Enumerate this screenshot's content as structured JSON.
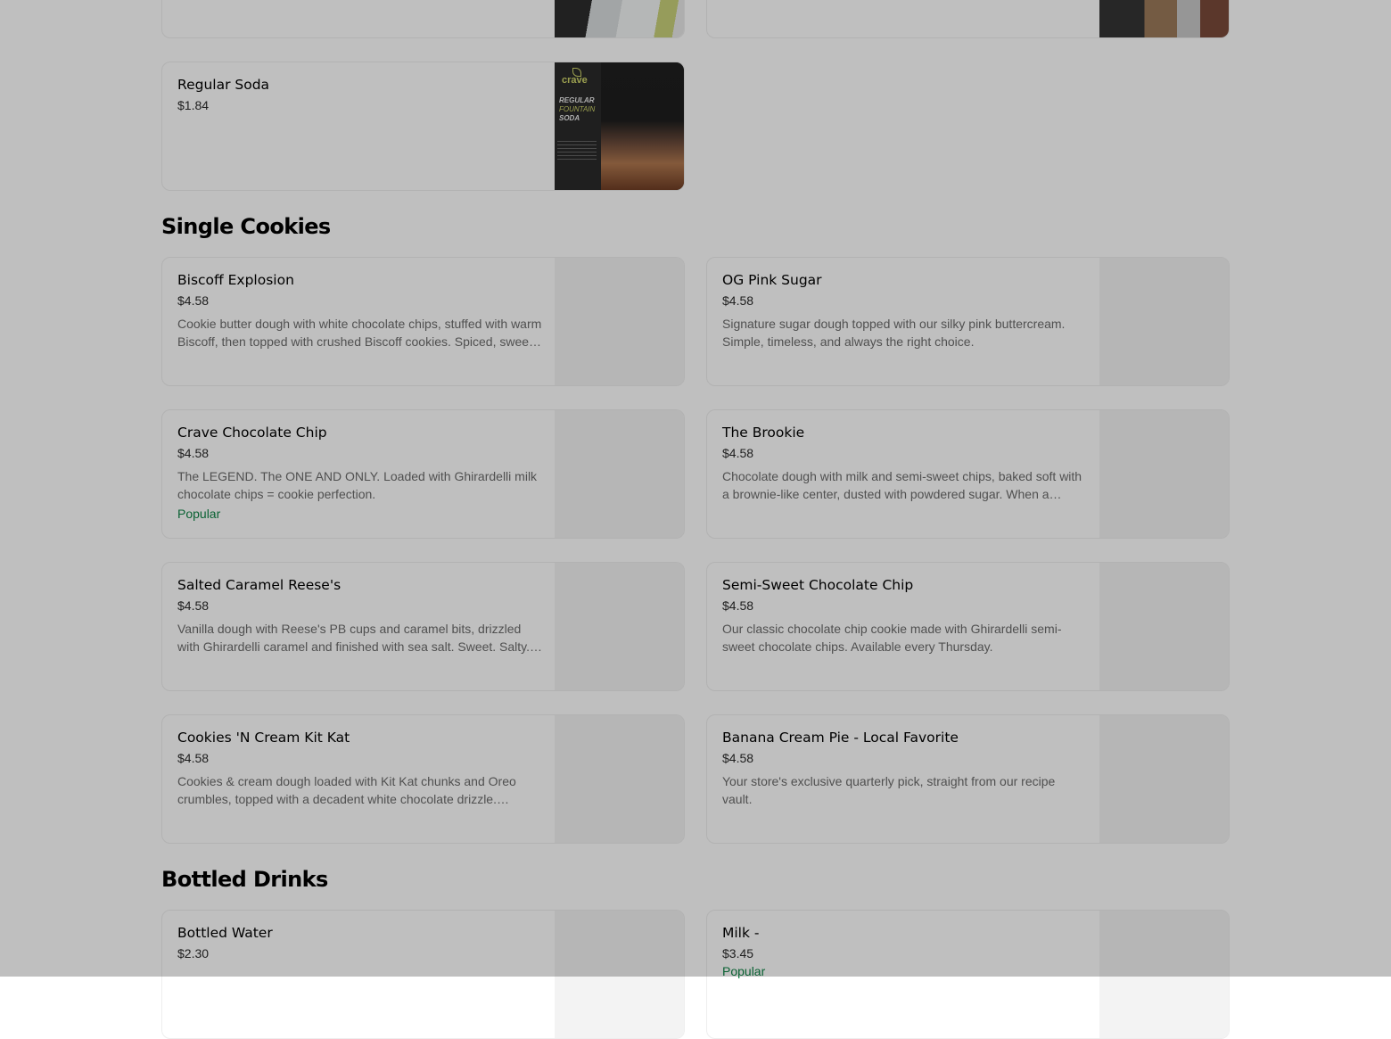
{
  "sections": {
    "drinks": {
      "items": [
        {
          "name": "",
          "price": ""
        },
        {
          "name": "",
          "price": ""
        },
        {
          "name": "Regular Soda",
          "price": "$1.84"
        }
      ],
      "soda_image": {
        "brand": "crave",
        "line1": "REGULAR",
        "line2": "FOUNTAIN",
        "line3": "SODA"
      }
    },
    "single_cookies": {
      "title": "Single Cookies",
      "items": [
        {
          "name": "Biscoff Explosion",
          "price": "$4.58",
          "description": "Cookie butter dough with white chocolate chips, stuffed with warm Biscoff, then topped with crushed Biscoff cookies. Spiced, sweet, and totally unreal."
        },
        {
          "name": "OG Pink Sugar",
          "price": "$4.58",
          "description": "Signature sugar dough topped with our silky pink buttercream. Simple, timeless, and always the right choice."
        },
        {
          "name": "Crave Chocolate Chip",
          "price": "$4.58",
          "description": "The LEGEND. The ONE AND ONLY. Loaded with Ghirardelli milk chocolate chips = cookie perfection.",
          "badge": "Popular"
        },
        {
          "name": "The Brookie",
          "price": "$4.58",
          "description": "Chocolate dough with milk and semi-sweet chips, baked soft with a brownie-like center, dusted with powdered sugar. When a brownie and a cookie collide."
        },
        {
          "name": "Salted Caramel Reese's",
          "price": "$4.58",
          "description": "Vanilla dough with Reese's PB cups and caramel bits, drizzled with Ghirardelli caramel and finished with sea salt. Sweet. Salty. Perfect."
        },
        {
          "name": "Semi-Sweet Chocolate Chip",
          "price": "$4.58",
          "description": "Our classic chocolate chip cookie made with Ghirardelli semi-sweet chocolate chips. Available every Thursday."
        },
        {
          "name": "Cookies 'N Cream Kit Kat",
          "price": "$4.58",
          "description": "Cookies & cream dough loaded with Kit Kat chunks and Oreo crumbles, topped with a decadent white chocolate drizzle. Crunchy, creamy, and dreamy."
        },
        {
          "name": "Banana Cream Pie - Local Favorite",
          "price": "$4.58",
          "description": "Your store's exclusive quarterly pick, straight from our recipe vault."
        }
      ]
    },
    "bottled_drinks": {
      "title": "Bottled Drinks",
      "items": [
        {
          "name": "Bottled Water",
          "price": "$2.30"
        },
        {
          "name": "Milk -",
          "price": "$3.45",
          "badge": "Popular"
        }
      ]
    }
  }
}
